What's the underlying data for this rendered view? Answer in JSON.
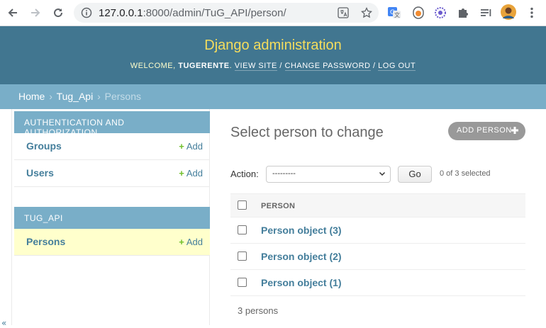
{
  "browser": {
    "url_host": "127.0.0.1",
    "url_rest": ":8000/admin/TuG_API/person/",
    "icons": [
      "back-icon",
      "forward-icon",
      "reload-icon",
      "info-icon",
      "translate-icon",
      "bookmark-star-icon",
      "google-translate-extension-icon",
      "extension-orange-icon",
      "extension-purple-icon",
      "puzzle-icon",
      "reading-list-icon",
      "avatar",
      "menu-icon"
    ]
  },
  "header": {
    "branding": "Django administration",
    "welcome": "WELCOME, ",
    "username": "TUGERENTE",
    "period": ". ",
    "view_site": "VIEW SITE",
    "sep1": " / ",
    "change_password": "CHANGE PASSWORD",
    "sep2": " / ",
    "log_out": "LOG OUT"
  },
  "breadcrumbs": {
    "home": "Home",
    "app": "Tug_Api",
    "current": "Persons",
    "arrow": "›"
  },
  "sidebar": {
    "auth_caption": "AUTHENTICATION AND AUTHORIZATION",
    "groups": "Groups",
    "users": "Users",
    "add": "Add",
    "tug_caption": "TUG_API",
    "persons": "Persons"
  },
  "main": {
    "title": "Select person to change",
    "add_button": "ADD PERSON",
    "action_label": "Action:",
    "action_selected": "---------",
    "go": "Go",
    "selected_count": "0 of 3 selected",
    "column_header": "PERSON",
    "rows": [
      "Person object (3)",
      "Person object (2)",
      "Person object (1)"
    ],
    "paginator": "3 persons"
  },
  "colors": {
    "header_bg": "#417690",
    "branding": "#f5dd5d",
    "breadcrumb_bg": "#79aec8",
    "link": "#447e9b",
    "add_green": "#70bf2b",
    "current_row": "#ffffcc"
  }
}
